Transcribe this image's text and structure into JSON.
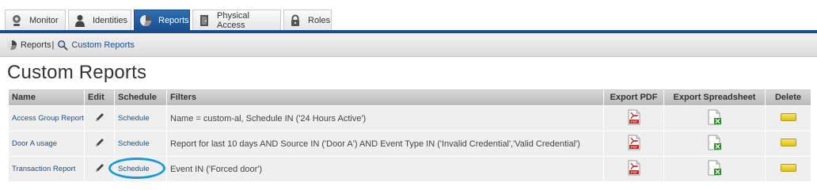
{
  "tabs": [
    {
      "label": "Monitor",
      "icon": "webcam-icon",
      "active": false
    },
    {
      "label": "Identities",
      "icon": "person-icon",
      "active": false
    },
    {
      "label": "Reports",
      "icon": "pie-chart-icon",
      "active": true
    },
    {
      "label": "Physical Access",
      "icon": "door-icon",
      "active": false
    },
    {
      "label": "Roles",
      "icon": "lock-icon",
      "active": false
    }
  ],
  "breadcrumb": {
    "root": "Reports",
    "separator": "|",
    "current": "Custom Reports"
  },
  "page_title": "Custom Reports",
  "table": {
    "headers": {
      "name": "Name",
      "edit": "Edit",
      "schedule": "Schedule",
      "filters": "Filters",
      "export_pdf": "Export PDF",
      "export_spreadsheet": "Export Spreadsheet",
      "delete": "Delete"
    },
    "rows": [
      {
        "name": "Access Group Report",
        "schedule": "Schedule",
        "filters": "Name = custom-al, Schedule IN ('24 Hours Active')"
      },
      {
        "name": "Door A usage",
        "schedule": "Schedule",
        "filters": "Report for last 10 days AND Source IN ('Door A') AND Event Type IN ('Invalid Credential','Valid Credential')"
      },
      {
        "name": "Transaction Report",
        "schedule": "Schedule",
        "filters": "Event IN ('Forced door')"
      }
    ]
  },
  "colors": {
    "accent": "#1b4f8c",
    "link": "#1a4f8c",
    "highlight": "#1a9ad6"
  }
}
